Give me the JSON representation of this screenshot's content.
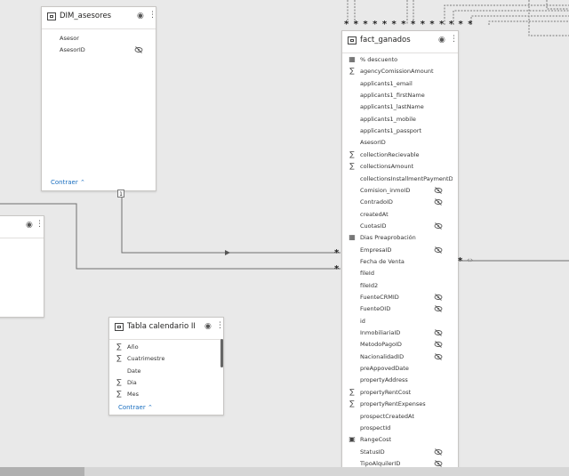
{
  "tables": {
    "dim_asesores": {
      "title": "DIM_asesores",
      "fields": [
        "Asesor",
        "AsesorID"
      ],
      "collapse_label": "Contraer"
    },
    "fact_ganados": {
      "title": "fact_ganados",
      "fields": [
        {
          "label": "% descuento",
          "icon": "calc-table-icon",
          "hidden": false
        },
        {
          "label": "agencyComissionAmount",
          "icon": "sigma-icon",
          "hidden": false
        },
        {
          "label": "applicants1_email",
          "icon": "",
          "hidden": false
        },
        {
          "label": "applicants1_firstName",
          "icon": "",
          "hidden": false
        },
        {
          "label": "applicants1_lastName",
          "icon": "",
          "hidden": false
        },
        {
          "label": "applicants1_mobile",
          "icon": "",
          "hidden": false
        },
        {
          "label": "applicants1_passport",
          "icon": "",
          "hidden": false
        },
        {
          "label": "AsesorID",
          "icon": "",
          "hidden": false
        },
        {
          "label": "collectionRecievable",
          "icon": "sigma-icon",
          "hidden": false
        },
        {
          "label": "collectionsAmount",
          "icon": "sigma-icon",
          "hidden": false
        },
        {
          "label": "collectionsInstallmentPaymentD...",
          "icon": "",
          "hidden": false
        },
        {
          "label": "Comision_inmoID",
          "icon": "",
          "hidden": true
        },
        {
          "label": "ContradoID",
          "icon": "",
          "hidden": true
        },
        {
          "label": "createdAt",
          "icon": "",
          "hidden": false
        },
        {
          "label": "CuotasID",
          "icon": "",
          "hidden": true
        },
        {
          "label": "Dias Preaprobación",
          "icon": "calc-table-icon",
          "hidden": false
        },
        {
          "label": "EmpresaID",
          "icon": "",
          "hidden": true
        },
        {
          "label": "Fecha de Venta",
          "icon": "",
          "hidden": false
        },
        {
          "label": "fileId",
          "icon": "",
          "hidden": false
        },
        {
          "label": "fileId2",
          "icon": "",
          "hidden": false
        },
        {
          "label": "FuenteCRMID",
          "icon": "",
          "hidden": true
        },
        {
          "label": "FuenteOID",
          "icon": "",
          "hidden": true
        },
        {
          "label": "id",
          "icon": "",
          "hidden": false
        },
        {
          "label": "InmobiliariaID",
          "icon": "",
          "hidden": true
        },
        {
          "label": "MetodoPagoID",
          "icon": "",
          "hidden": true
        },
        {
          "label": "NacionalidadID",
          "icon": "",
          "hidden": true
        },
        {
          "label": "preAppovedDate",
          "icon": "",
          "hidden": false
        },
        {
          "label": "propertyAddress",
          "icon": "",
          "hidden": false
        },
        {
          "label": "propertyRentCost",
          "icon": "sigma-icon",
          "hidden": false
        },
        {
          "label": "propertyRentExpenses",
          "icon": "sigma-icon",
          "hidden": false
        },
        {
          "label": "prospectCreatedAt",
          "icon": "",
          "hidden": false
        },
        {
          "label": "prospectId",
          "icon": "",
          "hidden": false
        },
        {
          "label": "RangeCost",
          "icon": "range-icon",
          "hidden": false
        },
        {
          "label": "StatusID",
          "icon": "",
          "hidden": true
        },
        {
          "label": "TipoAlquilerID",
          "icon": "",
          "hidden": true
        }
      ]
    },
    "tabla_calendario": {
      "title": "Tabla calendario II",
      "fields": [
        {
          "label": "Año",
          "icon": "sigma-icon"
        },
        {
          "label": "Cuatrimestre",
          "icon": "sigma-icon"
        },
        {
          "label": "Date",
          "icon": ""
        },
        {
          "label": "Dia",
          "icon": "sigma-icon"
        },
        {
          "label": "Mes",
          "icon": "sigma-icon"
        }
      ],
      "collapse_label": "Contraer"
    }
  },
  "relationships": {
    "one_marker": "1",
    "many_marker": "*",
    "stars_top": "* * * * * * * *   * * * * * *"
  }
}
